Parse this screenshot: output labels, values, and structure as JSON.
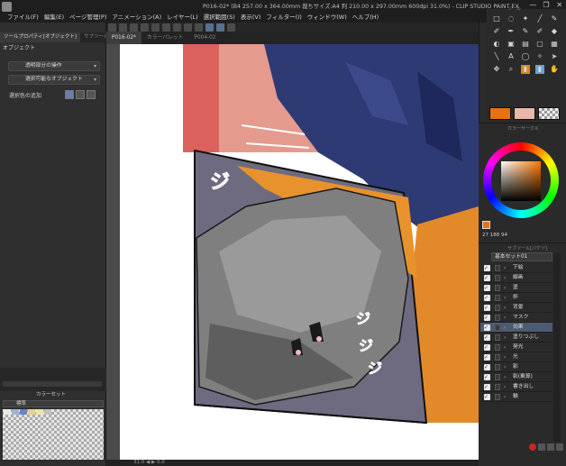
{
  "window": {
    "title": "P016-02* (B4 257.00 x 364.00mm 裁ちサイズ:A4 判 210.00 x 297.00mm 600dpi 31.0%) - CLIP STUDIO PAINT EX",
    "controls": [
      "—",
      "❐",
      "✕"
    ]
  },
  "menu": [
    "ファイル(F)",
    "編集(E)",
    "ページ管理(P)",
    "アニメーション(A)",
    "レイヤー(L)",
    "選択範囲(S)",
    "表示(V)",
    "フィルター(I)",
    "ウィンドウ(W)",
    "ヘルプ(H)"
  ],
  "left_panel": {
    "tabs": [
      "ツールプロパティ[オブジェクト]",
      "サブツール"
    ],
    "section": "オブジェクト",
    "dropdown1": "透明部分の操作",
    "dropdown2": "選択可能なオブジェクト",
    "selection_label": "選択色の追加",
    "colorset_tab": "カラーセット",
    "colorset_field": "標準"
  },
  "canvas": {
    "tabs": [
      "P016-02*",
      "カラーパレット",
      "P004-02"
    ],
    "zoom": "31.0",
    "status": "31.0  ◀  ▶  0.0"
  },
  "right_panel": {
    "tool_title": "ツール",
    "colorwheel_title": "カラーサークル",
    "color_values": "27  188  94",
    "fg_color": "#e87112",
    "bg_color": "#e8b8a8",
    "layer_title": "サブツール[バケツ]",
    "layer_set": "基本セット01",
    "layers": [
      {
        "name": "下絵",
        "selected": false
      },
      {
        "name": "線画",
        "selected": false
      },
      {
        "name": "塗",
        "selected": false
      },
      {
        "name": "枠",
        "selected": false
      },
      {
        "name": "背景",
        "selected": false
      },
      {
        "name": "マスク",
        "selected": false
      },
      {
        "name": "効果",
        "selected": true
      },
      {
        "name": "塗りつぶし",
        "selected": false
      },
      {
        "name": "発光",
        "selected": false
      },
      {
        "name": "光",
        "selected": false
      },
      {
        "name": "影",
        "selected": false
      },
      {
        "name": "影(乗算)",
        "selected": false
      },
      {
        "name": "書き出し",
        "selected": false
      },
      {
        "name": "輪",
        "selected": false
      }
    ]
  },
  "artwork": {
    "sfx_left": "ジ",
    "sfx_right_1": "ジ",
    "sfx_right_2": "ジ",
    "sfx_right_3": "ジ"
  }
}
